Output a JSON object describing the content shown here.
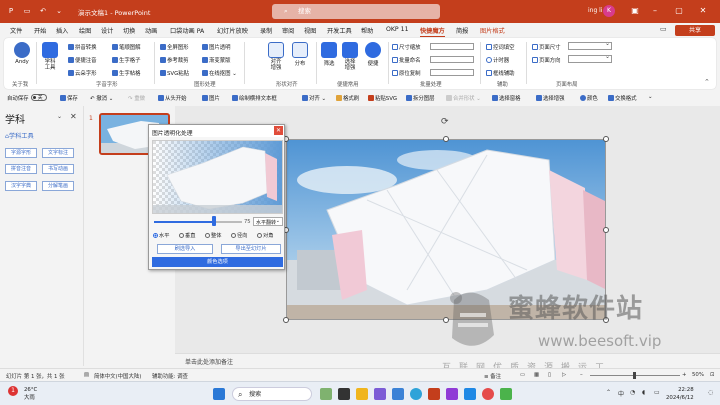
{
  "titlebar": {
    "doc_title": "演示文稿1 - PowerPoint",
    "search_placeholder": "搜索",
    "user_name": "ing li",
    "avatar_initial": "K",
    "share_label": "共享"
  },
  "menu_tabs": [
    "文件",
    "开始",
    "插入",
    "绘图",
    "设计",
    "切换",
    "动画",
    "口袋动画 PA",
    "幻灯片放映",
    "录制",
    "审阅",
    "视图",
    "开发工具",
    "帮助",
    "OKP 11",
    "快捷魔方",
    "简报",
    "图片格式"
  ],
  "active_tab": "快捷魔方",
  "ribbon": {
    "andy": "Andy",
    "about": "关于我",
    "xueke_tool": "学科工具",
    "font_group": {
      "items": [
        "拼音转换",
        "笔顺图解",
        "便捷注音",
        "生字格子",
        "云朵字形",
        "生字帖格"
      ],
      "label": "字音字形"
    },
    "shape_group": {
      "items": [
        "全屏图形",
        "图片透明",
        "参考裁剪",
        "渐变蒙版",
        "SVG粘贴",
        "在线抠图"
      ],
      "label": "图形处理"
    },
    "align": {
      "items": [
        "对齐增强",
        "分布"
      ],
      "label": "形状对齐"
    },
    "select": {
      "items": [
        "筛选",
        "选择增强",
        "便捷"
      ],
      "label": "便捷常用"
    },
    "batch": {
      "items": [
        "尺寸缩放",
        "批量命名",
        "原位复制"
      ],
      "label": "批量处理"
    },
    "assist": {
      "items": [
        "控词填空",
        "计时器",
        "框线辅助"
      ],
      "label": "辅助"
    },
    "page": {
      "items": [
        "页面尺寸",
        "页面方向"
      ],
      "label": "页面布局"
    }
  },
  "quickbar": {
    "autosave": "自动保存",
    "autosave_state": "关",
    "items": [
      "保存",
      "撤消",
      "重做",
      "从头开始",
      "图片",
      "绘制横排文本框",
      "对齐",
      "格式刷",
      "粘贴SVG",
      "拆分图层",
      "合并形状",
      "选择窗格",
      "选择增强",
      "颜色",
      "交换格式"
    ],
    "dim_items": [
      "重做",
      "合并形状"
    ]
  },
  "left_panel": {
    "title": "学科",
    "sub": "⌂学科工具",
    "buttons": [
      "字源字形",
      "文字标注",
      "拼音注音",
      "书写动画",
      "汉字字典",
      "分解笔画"
    ]
  },
  "slide": {
    "number": "1"
  },
  "dialog": {
    "title": "图片透明化处理",
    "slider_value": "75",
    "slider_fraction": 0.68,
    "dropdown": "水平翻转",
    "radios": [
      "水平",
      "垂直",
      "整体",
      "径向",
      "对角"
    ],
    "selected_radio": "水平",
    "import_btn": "刷选导入",
    "export_btn": "导出至幻灯片",
    "color_btn": "颜色选项"
  },
  "notes_placeholder": "单击此处添加备注",
  "statusbar": {
    "slide_info": "幻灯片 第 1 张，共 1 张",
    "language": "简体中文(中国大陆)",
    "accessibility": "辅助功能: 调查",
    "notes": "备注",
    "zoom": "50%"
  },
  "taskbar": {
    "weather_temp": "26°C",
    "weather_desc": "大雨",
    "weather_badge": "1",
    "search": "搜索",
    "lang": "中",
    "time": "22:28",
    "date": "2024/6/12"
  },
  "watermark": {
    "brand": "蜜蜂软件站",
    "url": "www.beesoft.vip",
    "slogan": "互联网优质资源搬运工"
  },
  "colors": {
    "accent": "#c43e1c",
    "dialog_blue": "#2f6be0",
    "panel_blue": "#3b6cc7"
  }
}
